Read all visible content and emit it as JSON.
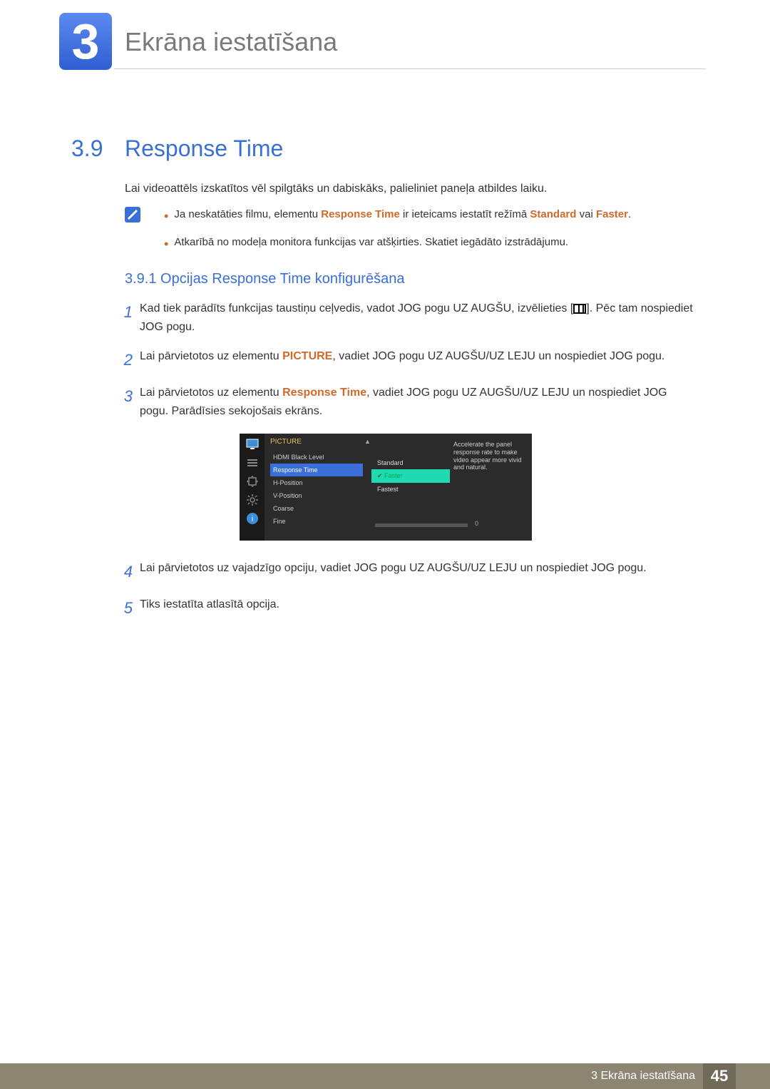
{
  "chapter": {
    "number": "3",
    "title": "Ekrāna iestatīšana"
  },
  "section": {
    "number": "3.9",
    "title": "Response Time"
  },
  "intro": "Lai videoattēls izskatītos vēl spilgtāks un dabiskāks, palieliniet paneļa atbildes laiku.",
  "notes": {
    "b1a": "Ja neskatāties filmu, elementu ",
    "b1h1": "Response Time",
    "b1b": " ir ieteicams iestatīt režīmā ",
    "b1h2": "Standard",
    "b1c": " vai ",
    "b1h3": "Faster",
    "b1d": ".",
    "b2": "Atkarībā no modeļa monitora funkcijas var atšķirties. Skatiet iegādāto izstrādājumu."
  },
  "subsection": "3.9.1   Opcijas Response Time konfigurēšana",
  "steps": {
    "s1a": "Kad tiek parādīts funkcijas taustiņu ceļvedis, vadot JOG pogu UZ AUGŠU, izvēlieties [",
    "s1b": "]. Pēc tam nospiediet JOG pogu.",
    "s2a": "Lai pārvietotos uz elementu ",
    "s2h": "PICTURE",
    "s2b": ", vadiet JOG pogu UZ AUGŠU/UZ LEJU un nospiediet JOG pogu.",
    "s3a": "Lai pārvietotos uz elementu ",
    "s3h": "Response Time",
    "s3b": ", vadiet JOG pogu UZ AUGŠU/UZ LEJU un nospiediet JOG pogu. Parādīsies sekojošais ekrāns.",
    "s4": "Lai pārvietotos uz vajadzīgo opciju, vadiet JOG pogu UZ AUGŠU/UZ LEJU un nospiediet JOG pogu.",
    "s5": "Tiks iestatīta atlasītā opcija."
  },
  "osd": {
    "title": "PICTURE",
    "menu": [
      "HDMI Black Level",
      "Response Time",
      "H-Position",
      "V-Position",
      "Coarse",
      "Fine"
    ],
    "opts": [
      "Standard",
      "Faster",
      "Fastest"
    ],
    "fineVal": "0",
    "desc": "Accelerate the panel response rate to make video appear more vivid and natural."
  },
  "footer": {
    "text": "3 Ekrāna iestatīšana",
    "page": "45"
  }
}
